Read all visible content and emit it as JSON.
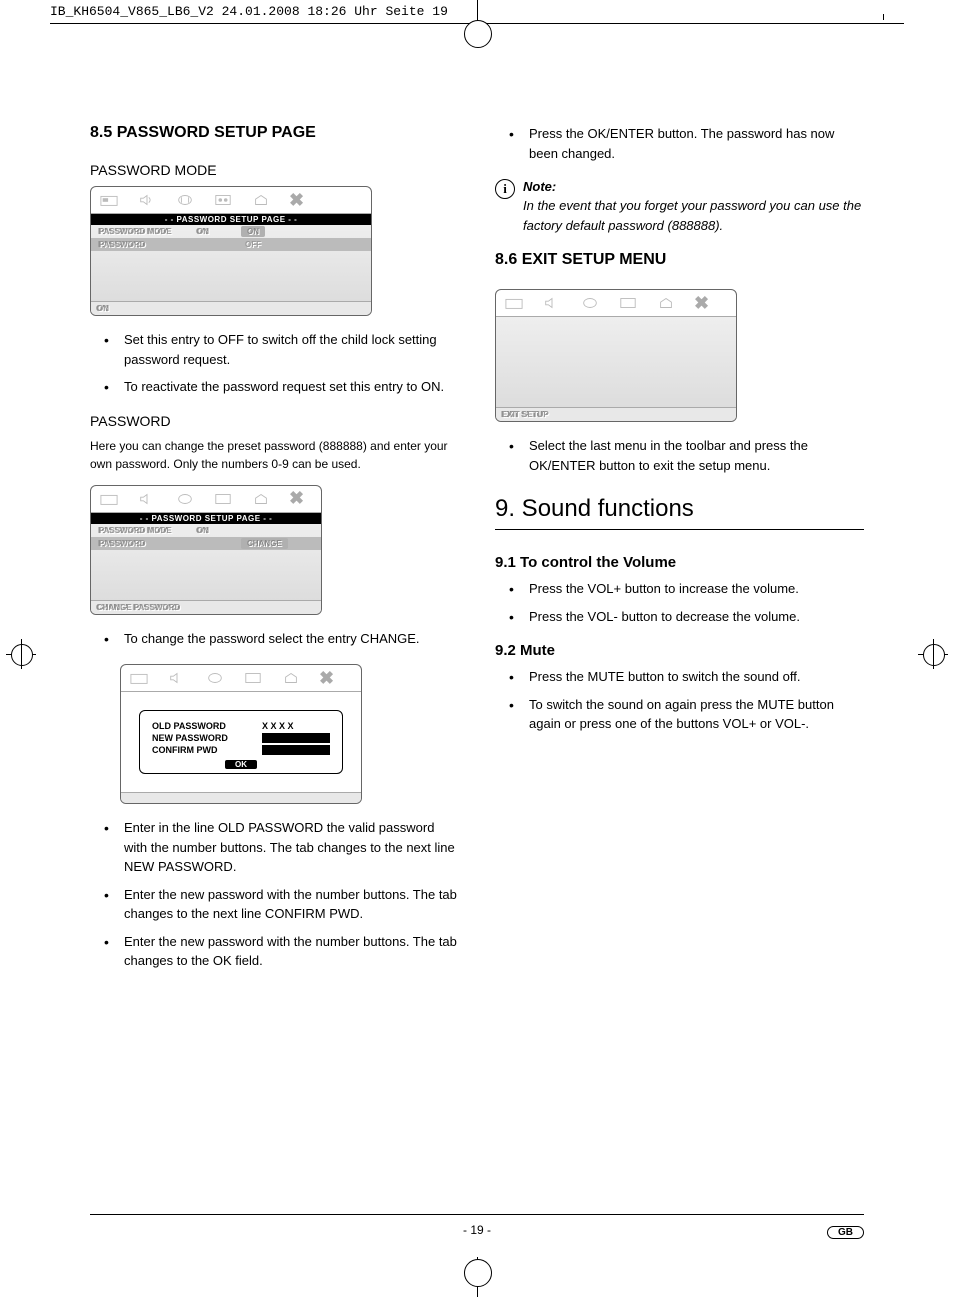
{
  "header_info": "IB_KH6504_V865_LB6_V2  24.01.2008  18:26 Uhr  Seite 19",
  "left": {
    "h_section": "8.5 PASSWORD SETUP PAGE",
    "h_passmode": "PASSWORD MODE",
    "osd1": {
      "title": "- - PASSWORD SETUP PAGE - -",
      "row1_label": "PASSWORD MODE",
      "row1_val": "ON",
      "row1_opt1": "ON",
      "row2_label": "PASSWORD",
      "row2_opt": "OFF",
      "status": "ON"
    },
    "bul1_a": "Set this entry to OFF to switch off the child lock setting password request.",
    "bul1_b": "To reactivate the password request set this entry to ON.",
    "h_password": "PASSWORD",
    "pass_intro": "Here you can change the preset password (888888) and enter your own password. Only the numbers 0-9 can be used.",
    "osd2": {
      "title": "- - PASSWORD SETUP PAGE - -",
      "row1_label": "PASSWORD MODE",
      "row1_val": "ON",
      "row2_label": "PASSWORD",
      "row2_opt": "CHANGE",
      "status": "CHANGE PASSWORD"
    },
    "bul2_a": "To change the password select the entry CHANGE.",
    "osd3": {
      "old": "OLD PASSWORD",
      "old_val": "X X X X",
      "new": "NEW PASSWORD",
      "confirm": "CONFIRM PWD",
      "ok": "OK"
    },
    "bul3_a": "Enter in the line OLD PASSWORD the valid password with the number buttons. The tab changes to the next line NEW PASSWORD.",
    "bul3_b": "Enter the new password with the number buttons. The tab changes to the next line CONFIRM PWD.",
    "bul3_c": "Enter the new password with the number buttons. The tab changes to the OK field."
  },
  "right": {
    "bul_top": "Press the OK/ENTER button. The password has now been changed.",
    "note_title": "Note:",
    "note_body": "In the event that you forget your password you can use the factory default password (888888).",
    "h_exit": "8.6 EXIT SETUP MENU",
    "osd_exit_status": "EXIT SETUP",
    "bul_exit": "Select the last menu in the toolbar and press the OK/ENTER button to exit the setup menu.",
    "h9": "9. Sound functions",
    "h91": "9.1 To control the Volume",
    "bul91_a": "Press the VOL+ button to increase the volume.",
    "bul91_b": "Press the VOL-  button to decrease the volume.",
    "h92": "9.2 Mute",
    "bul92_a": "Press the MUTE button to switch the sound off.",
    "bul92_b": "To switch the sound on again press the MUTE button again or press one of the buttons VOL+ or VOL-."
  },
  "footer_page": "- 19 -",
  "footer_badge": "GB"
}
